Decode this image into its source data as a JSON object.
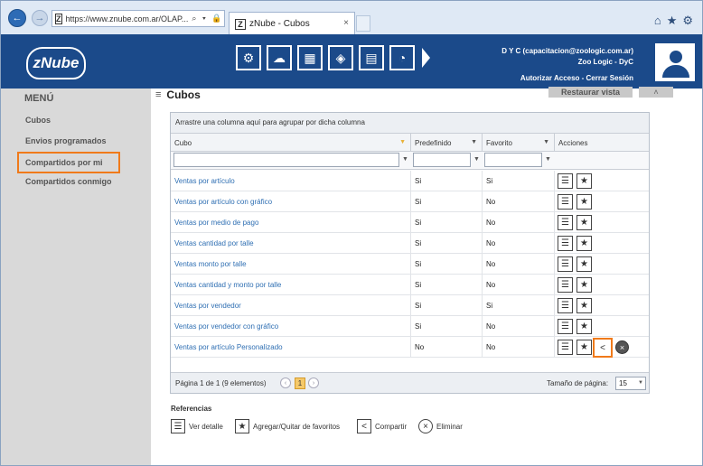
{
  "browser": {
    "url": "https://www.znube.com.ar/OLAP...",
    "url_tools": "⌕ ▾ 🔒 C",
    "tab_title": "zNube - Cubos",
    "tab_close": "×",
    "tab_favicon": "Z",
    "addr_favicon": "Z"
  },
  "app": {
    "logo_text": "zNube",
    "user_line1": "D Y C (capacitacion@zoologic.com.ar)",
    "user_line2": "Zoo Logic - DyC",
    "user_actions": "Autorizar Acceso - Cerrar Sesión",
    "modules": [
      "⚙",
      "☁",
      "▦",
      "◈",
      "▤",
      "◔"
    ]
  },
  "sidebar": {
    "title": "MENÚ",
    "items": [
      "Cubos",
      "Envios programados",
      "Compartidos por mi",
      "Compartidos conmigo"
    ],
    "active_index": 2
  },
  "page": {
    "menu_glyph": "≡",
    "title": "Cubos",
    "restore_label": "Restaurar vista",
    "collapse_label": "˄"
  },
  "grid": {
    "group_hint": "Arrastre una columna aquí para agrupar por dicha columna",
    "columns": [
      "Cubo",
      "Predefinido",
      "Favorito",
      "Acciones"
    ],
    "rows": [
      {
        "name": "Ventas por artículo",
        "predefinido": "Si",
        "favorito": "Si"
      },
      {
        "name": "Ventas por artículo con gráfico",
        "predefinido": "Si",
        "favorito": "No"
      },
      {
        "name": "Ventas por medio de pago",
        "predefinido": "Si",
        "favorito": "No"
      },
      {
        "name": "Ventas cantidad por talle",
        "predefinido": "Si",
        "favorito": "No"
      },
      {
        "name": "Ventas monto por talle",
        "predefinido": "Si",
        "favorito": "No"
      },
      {
        "name": "Ventas cantidad y monto por talle",
        "predefinido": "Si",
        "favorito": "No"
      },
      {
        "name": "Ventas por vendedor",
        "predefinido": "Si",
        "favorito": "Si"
      },
      {
        "name": "Ventas por vendedor con gráfico",
        "predefinido": "Si",
        "favorito": "No"
      },
      {
        "name": "Ventas por artículo Personalizado",
        "predefinido": "No",
        "favorito": "No"
      }
    ],
    "pager_text": "Página 1 de 1 (9 elementos)",
    "current_page": "1",
    "page_size_label": "Tamaño de página:",
    "page_size": "15"
  },
  "references": {
    "title": "Referencias",
    "items": [
      "Ver detalle",
      "Agregar/Quitar de favoritos",
      "Compartir",
      "Eliminar"
    ]
  },
  "colors": {
    "header_bg": "#1b4a8a",
    "highlight": "#f07a1a",
    "link": "#2f6fb3"
  }
}
